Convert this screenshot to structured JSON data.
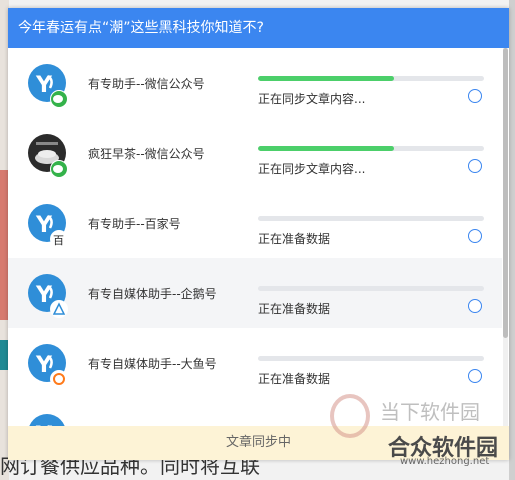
{
  "dialog": {
    "title": "今年春运有点“潮”这些黑科技你知道不?",
    "footer_status": "文章同步中"
  },
  "accounts": [
    {
      "name": "有专助手--微信公众号",
      "status": "正在同步文章内容...",
      "progress": 0.6,
      "avatar": "youzhuan-logo",
      "badge": "wechat-icon",
      "highlighted": false
    },
    {
      "name": "疯狂早茶--微信公众号",
      "status": "正在同步文章内容...",
      "progress": 0.6,
      "avatar": "tea-photo",
      "badge": "wechat-icon",
      "highlighted": false
    },
    {
      "name": "有专助手--百家号",
      "status": "正在准备数据",
      "progress": 0,
      "avatar": "youzhuan-logo",
      "badge": "baijiahao-icon",
      "highlighted": false
    },
    {
      "name": "有专自媒体助手--企鹅号",
      "status": "正在准备数据",
      "progress": 0,
      "avatar": "youzhuan-logo",
      "badge": "penguin-icon",
      "highlighted": true
    },
    {
      "name": "有专自媒体助手--大鱼号",
      "status": "正在准备数据",
      "progress": 0,
      "avatar": "youzhuan-logo",
      "badge": "dayu-icon",
      "highlighted": false
    },
    {
      "name": "",
      "status": "",
      "progress": 0,
      "avatar": "youzhuan-logo",
      "badge": "",
      "highlighted": false
    }
  ],
  "background_text": "网订餐供应品种。同时将互联",
  "watermark": {
    "line1": "当下软件园",
    "line2": "合众软件园",
    "line3": "www.hezhong.net"
  },
  "colors": {
    "title_bar": "#3b86f0",
    "progress": "#4ccf6a",
    "footer": "#fdf3d6"
  }
}
